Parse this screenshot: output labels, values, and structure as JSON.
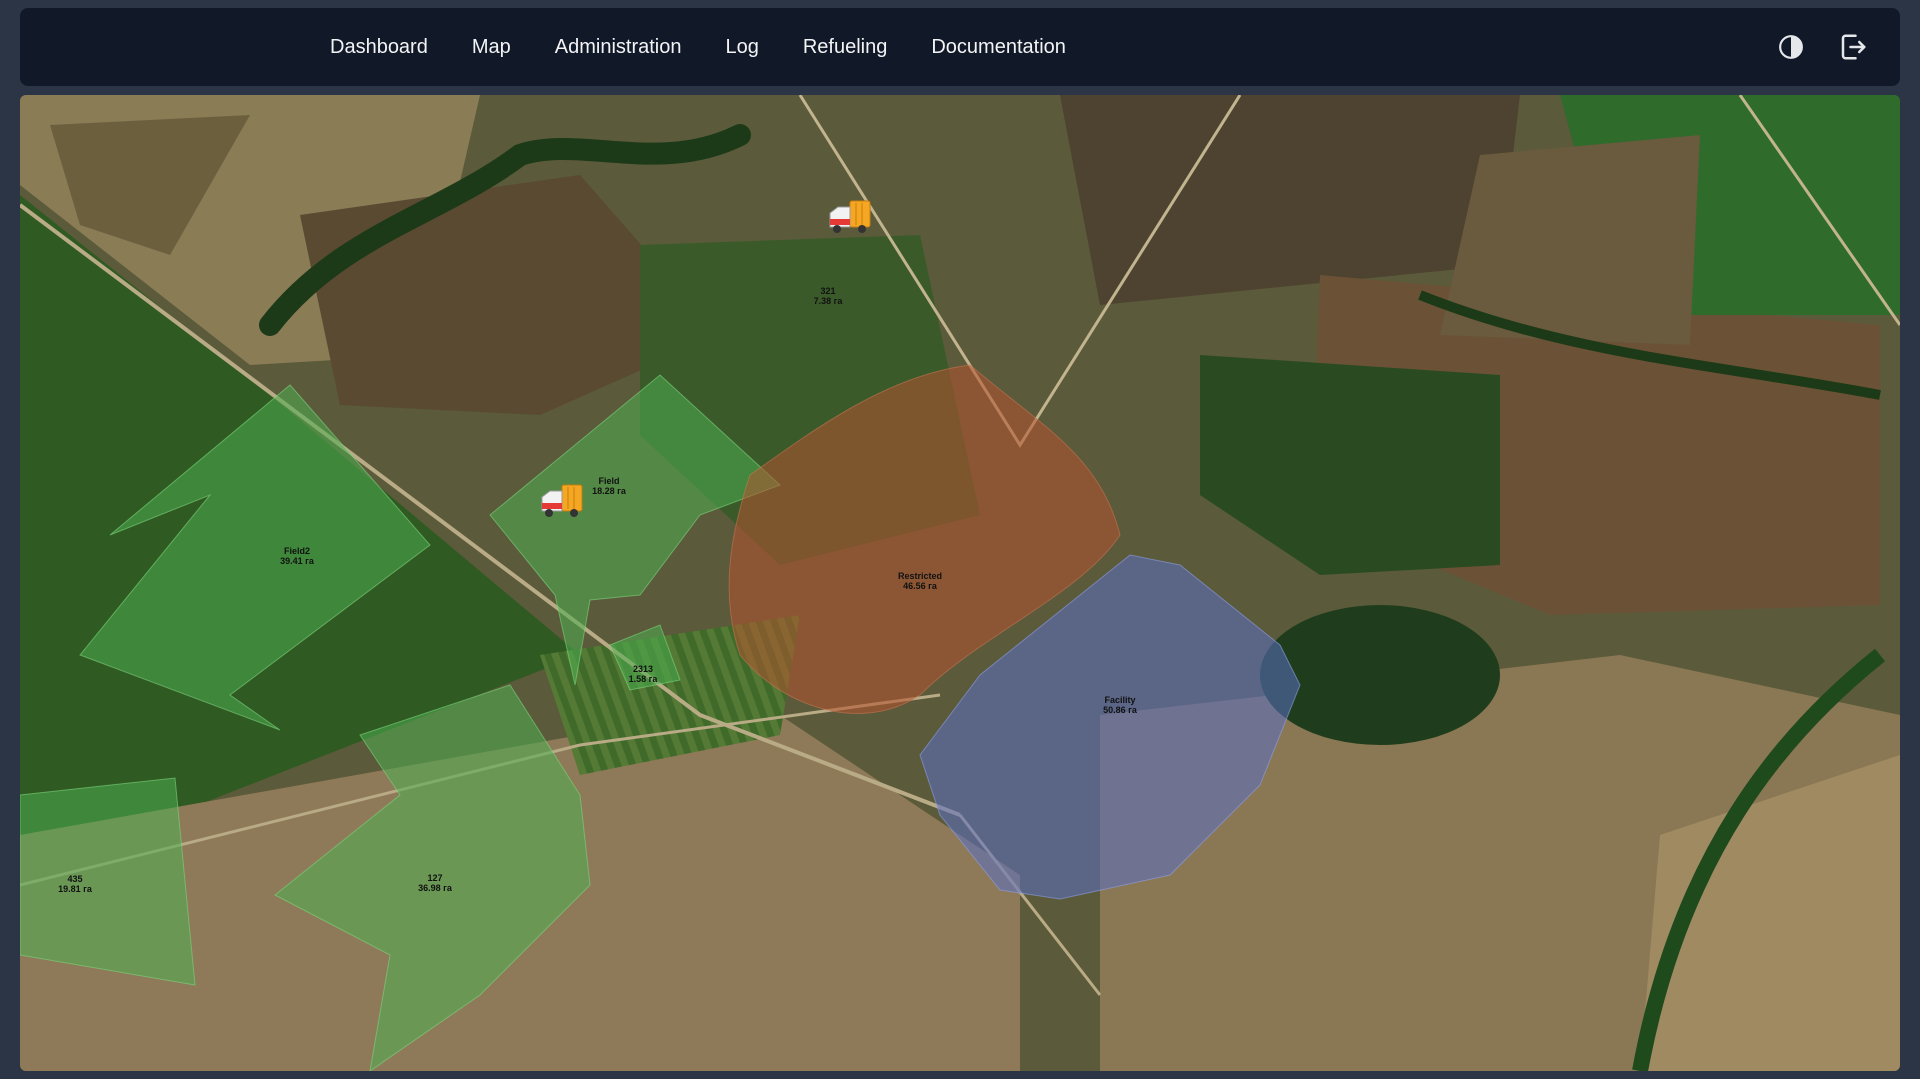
{
  "nav": {
    "links": [
      "Dashboard",
      "Map",
      "Administration",
      "Log",
      "Refueling",
      "Documentation"
    ],
    "theme_toggle_icon": "contrast-icon",
    "logout_icon": "logout-icon"
  },
  "map": {
    "zones": [
      {
        "id": "field",
        "name": "Field",
        "area": "18.28 га",
        "color": "#4caf50"
      },
      {
        "id": "field2",
        "name": "Field2",
        "area": "39.41 га",
        "color": "#4caf50"
      },
      {
        "id": "restricted",
        "name": "Restricted",
        "area": "46.56 га",
        "color": "#b5542f"
      },
      {
        "id": "facility",
        "name": "Facility",
        "area": "50.86 га",
        "color": "#5b6fc4"
      },
      {
        "id": "z2313",
        "name": "2313",
        "area": "1.58 га",
        "color": "#4caf50"
      },
      {
        "id": "z435",
        "name": "435",
        "area": "19.81 га",
        "color": "#4caf50"
      },
      {
        "id": "z127",
        "name": "127",
        "area": "36.98 га",
        "color": "#4caf50"
      },
      {
        "id": "z321",
        "name": "321",
        "area": "7.38 га",
        "color": "#4caf50"
      }
    ],
    "vehicles": [
      {
        "id": "truck-1",
        "icon": "truck-icon"
      },
      {
        "id": "truck-2",
        "icon": "truck-icon"
      }
    ]
  }
}
